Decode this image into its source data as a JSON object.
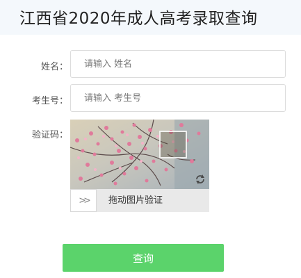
{
  "header": {
    "title": "江西省2020年成人高考录取查询"
  },
  "form": {
    "name": {
      "label": "姓名：",
      "value": "",
      "placeholder": "请输入 姓名"
    },
    "exam_number": {
      "label": "考生号：",
      "value": "",
      "placeholder": "请输入 考生号"
    },
    "captcha": {
      "label": "验证码：",
      "slider_text": "拖动图片验证",
      "handle_icon": "double-chevron-right-icon",
      "refresh_icon": "refresh-icon"
    },
    "submit_label": "查询"
  },
  "colors": {
    "header_bg": "#f4f8fc",
    "button_bg": "#5bd36b",
    "slider_bg": "#e9e9e9"
  }
}
